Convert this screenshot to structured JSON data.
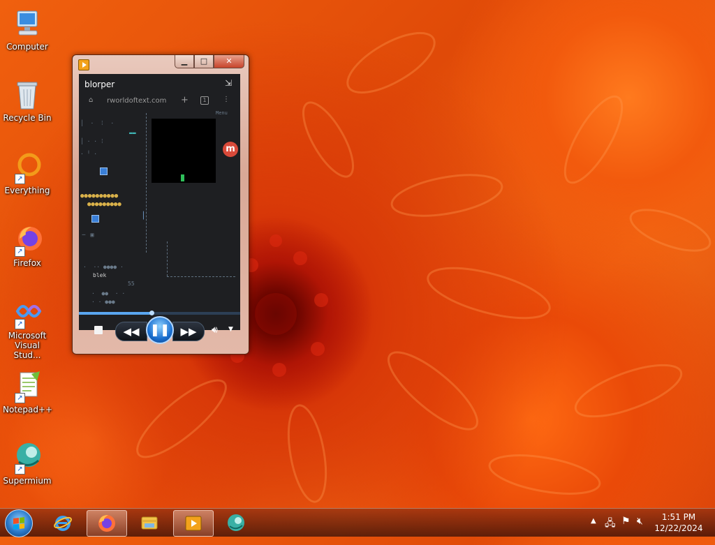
{
  "desktop": {
    "icons": [
      {
        "label": "Computer",
        "icon": "computer-icon"
      },
      {
        "label": "Recycle Bin",
        "icon": "recycle-bin-icon"
      },
      {
        "label": "Everything",
        "icon": "everything-icon"
      },
      {
        "label": "Firefox",
        "icon": "firefox-icon"
      },
      {
        "label": "Microsoft Visual Stud...",
        "icon": "visual-studio-icon"
      },
      {
        "label": "Notepad++",
        "icon": "notepadpp-icon"
      },
      {
        "label": "Supermium",
        "icon": "supermium-icon"
      }
    ]
  },
  "player": {
    "video_title": "blorper",
    "video_url": "rworldoftext.com",
    "menu_text": "Menu",
    "progress": 0.45,
    "controls": {
      "stop": "stop-icon",
      "rewind": "rewind-icon",
      "pause": "pause-icon",
      "fast_forward": "fast-forward-icon",
      "volume": "volume-icon"
    },
    "video_texts": {
      "t1": "blek",
      "t2": "55"
    }
  },
  "taskbar": {
    "items": [
      "internet-explorer-icon",
      "firefox-icon",
      "file-explorer-icon",
      "media-player-icon",
      "supermium-icon"
    ],
    "clock_time": "1:51 PM",
    "clock_date": "12/22/2024"
  },
  "colors": {
    "accent": "#1a6fcf",
    "taskbar": "#5a1a0a"
  }
}
